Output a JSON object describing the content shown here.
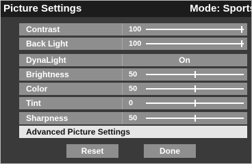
{
  "header": {
    "title": "Picture Settings",
    "mode": "Mode: Sports"
  },
  "settings": [
    {
      "label": "Contrast",
      "value": "100",
      "level": 1.0
    },
    {
      "label": "Back Light",
      "value": "100",
      "level": 1.0
    },
    {
      "label": "DynaLight",
      "value": "On"
    },
    {
      "label": "Brightness",
      "value": "50",
      "level": 0.5
    },
    {
      "label": "Color",
      "value": "50",
      "level": 0.5
    },
    {
      "label": "Tint",
      "value": "0",
      "level": 0.5
    },
    {
      "label": "Sharpness",
      "value": "50",
      "level": 0.5
    }
  ],
  "advanced": {
    "label": "Advanced Picture Settings"
  },
  "buttons": {
    "reset": "Reset",
    "done": "Done"
  }
}
